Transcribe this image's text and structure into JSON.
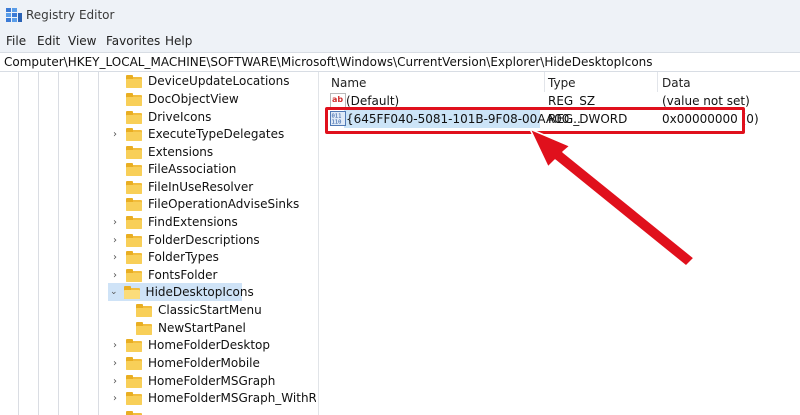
{
  "window": {
    "title": "Registry Editor"
  },
  "menu": [
    "File",
    "Edit",
    "View",
    "Favorites",
    "Help"
  ],
  "address": "Computer\\HKEY_LOCAL_MACHINE\\SOFTWARE\\Microsoft\\Windows\\CurrentVersion\\Explorer\\HideDesktopIcons",
  "tree": {
    "items": [
      {
        "label": "DeviceUpdateLocations",
        "expander": ""
      },
      {
        "label": "DocObjectView",
        "expander": ""
      },
      {
        "label": "DriveIcons",
        "expander": ""
      },
      {
        "label": "ExecuteTypeDelegates",
        "expander": "›"
      },
      {
        "label": "Extensions",
        "expander": ""
      },
      {
        "label": "FileAssociation",
        "expander": ""
      },
      {
        "label": "FileInUseResolver",
        "expander": ""
      },
      {
        "label": "FileOperationAdviseSinks",
        "expander": ""
      },
      {
        "label": "FindExtensions",
        "expander": "›"
      },
      {
        "label": "FolderDescriptions",
        "expander": "›"
      },
      {
        "label": "FolderTypes",
        "expander": "›"
      },
      {
        "label": "FontsFolder",
        "expander": "›"
      },
      {
        "label": "HideDesktopIcons",
        "expander": "⌄",
        "selected": true
      },
      {
        "label": "ClassicStartMenu",
        "child": true
      },
      {
        "label": "NewStartPanel",
        "child": true
      },
      {
        "label": "HomeFolderDesktop",
        "expander": "›"
      },
      {
        "label": "HomeFolderMobile",
        "expander": "›"
      },
      {
        "label": "HomeFolderMSGraph",
        "expander": "›"
      },
      {
        "label": "HomeFolderMSGraph_WithReco",
        "expander": "›"
      }
    ]
  },
  "list": {
    "columns": [
      "Name",
      "Type",
      "Data"
    ],
    "rows": [
      {
        "name": "(Default)",
        "type": "REG_SZ",
        "data": "(value not set)",
        "icon": "string-value-icon"
      },
      {
        "name": "{645FF040-5081-101B-9F08-00AA00...",
        "type": "REG_DWORD",
        "data": "0x00000000 (0)",
        "icon": "dword-value-icon"
      }
    ]
  },
  "colors": {
    "annotation": "#e0101c",
    "selection": "#cce4f7",
    "folder": "#f8cf58"
  }
}
